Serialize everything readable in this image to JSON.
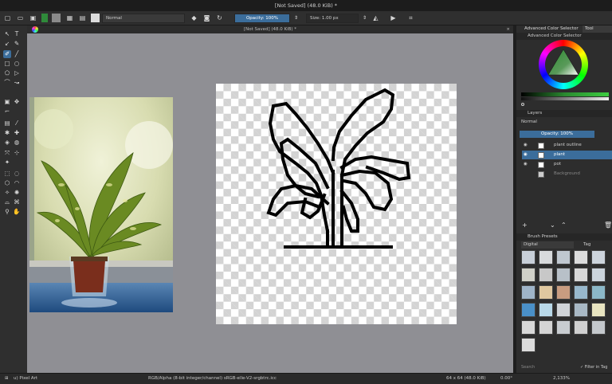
{
  "window": {
    "title": "[Not Saved]  (48.0 KiB) *"
  },
  "toolbar": {
    "blend_mode": "Normal",
    "opacity_label": "Opacity: 100%",
    "size_label": "Size: 1.00 px"
  },
  "canvas": {
    "tab_title": "[Not Saved]  (48.0 KiB) *",
    "close_glyph": "×"
  },
  "right_panel": {
    "tabs": [
      "Advanced Color Selector",
      "Tool Options"
    ],
    "color_selector_title": "Advanced Color Selector",
    "layers_title": "Layers",
    "layers_blend_mode": "Normal",
    "layers_opacity": "Opacity: 100%",
    "layers": [
      {
        "name": "plant outline",
        "visible": true,
        "selected": false
      },
      {
        "name": "plant",
        "visible": true,
        "selected": true
      },
      {
        "name": "pot",
        "visible": true,
        "selected": false
      },
      {
        "name": "Background",
        "visible": false,
        "selected": false
      }
    ],
    "brush_presets_title": "Brush Presets",
    "brush_preset_category": "Digital",
    "brush_preset_tag": "Tag",
    "search_placeholder": "Search",
    "filter_label": "Filter in Tag"
  },
  "statusbar": {
    "brush_name": "u) Pixel Art",
    "color_info": "RGB/Alpha (8-bit integer/channel)  sRGB-elle-V2-srgbtrc.icc",
    "image_size": "64 x 64 (48.0 KiB)",
    "rotation": "0.00°",
    "zoom": "2,133%"
  }
}
